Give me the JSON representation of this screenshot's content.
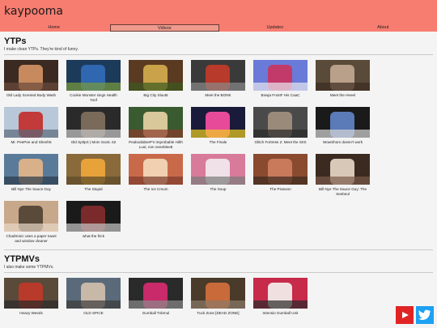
{
  "site": {
    "title": "kaypooma"
  },
  "nav": [
    {
      "label": "Home",
      "active": false
    },
    {
      "label": "Videos",
      "active": true
    },
    {
      "label": "Updates",
      "active": false
    },
    {
      "label": "About",
      "active": false
    }
  ],
  "ytps": {
    "title": "YTPs",
    "subtitle": "I make clean YTPs. They're kind of funny.",
    "videos": [
      {
        "title": "Old Lady Scented Body Wash",
        "colors": [
          "#3a2a22",
          "#c68a5e",
          "#6b4a3a"
        ]
      },
      {
        "title": "Cookie Monster sings Health Yoof",
        "colors": [
          "#1c3a5a",
          "#2f67b0",
          "#7a9b3a"
        ]
      },
      {
        "title": "Big City Sluut5",
        "colors": [
          "#5a3a20",
          "#c9a24a",
          "#3a5a20"
        ]
      },
      {
        "title": "Meet the BONK",
        "colors": [
          "#3a3a3a",
          "#b83a2a",
          "#8a8a8a"
        ]
      },
      {
        "title": "Bowja FrostF His CaaC",
        "colors": [
          "#6a7ad8",
          "#c23a6a",
          "#e8e8f0"
        ]
      },
      {
        "title": "Meet the Heeel",
        "colors": [
          "#5a4a3a",
          "#b8a08a",
          "#3a2a20"
        ]
      },
      {
        "title": "Mr. PeePee and Sheeh5",
        "colors": [
          "#b8c8d8",
          "#c23a3a",
          "#5a6a7a"
        ]
      },
      {
        "title": "Old SpIlpS | Mom Soo5. 62",
        "colors": [
          "#2a2a2a",
          "#7a6a5a",
          "#c8c8c8"
        ]
      },
      {
        "title": "PeabodabseP's Improbable Hilth Luul, non neeeblee8",
        "colors": [
          "#3a5a30",
          "#d8c89a",
          "#8a3a2a"
        ]
      },
      {
        "title": "The Finale",
        "colors": [
          "#1a1a3a",
          "#e84a9a",
          "#f0d020"
        ]
      },
      {
        "title": "Glitch Fortress 2: Meet the SIIS",
        "colors": [
          "#4a4a4a",
          "#9a8a7a",
          "#2a2a2a"
        ]
      },
      {
        "title": "WowShom doesn't work",
        "colors": [
          "#1a1a1a",
          "#5a7ab8",
          "#d8d8d8"
        ]
      },
      {
        "title": "Bill Nye The Sauce Guy",
        "colors": [
          "#5a7a9a",
          "#d8b08a",
          "#2a3a4a"
        ]
      },
      {
        "title": "The Stupid",
        "colors": [
          "#8a6a3a",
          "#e8a23a",
          "#5a4a2a"
        ]
      },
      {
        "title": "The Ice Cmum",
        "colors": [
          "#c86a4a",
          "#f0d0b0",
          "#7a3a2a"
        ]
      },
      {
        "title": "The Soup",
        "colors": [
          "#d87a9a",
          "#f0e0e8",
          "#7a7a7a"
        ]
      },
      {
        "title": "The Prasoon",
        "colors": [
          "#8a4a30",
          "#c87a5a",
          "#3a2a20"
        ]
      },
      {
        "title": "Bill Nye The Sauce Guy: The Seebeul",
        "colors": [
          "#3a2a20",
          "#d8c8b8",
          "#7a5a4a"
        ]
      },
      {
        "title": "Chadtronic uses a paper towel and window cleaner",
        "colors": [
          "#c8a88a",
          "#5a4a3a",
          "#e8d8c8"
        ]
      },
      {
        "title": "what the frick",
        "colors": [
          "#1a1a1a",
          "#7a2a2a",
          "#c8c8c8"
        ]
      }
    ]
  },
  "ytpmvs": {
    "title": "YTPMVs",
    "subtitle": "I also make some YTPMVs.",
    "videos": [
      {
        "title": "Heavy Weeds",
        "colors": [
          "#5a4a3a",
          "#b83a2a",
          "#2a2a2a"
        ]
      },
      {
        "title": "OLD SPICE",
        "colors": [
          "#5a6a7a",
          "#c8b8a8",
          "#3a3a3a"
        ]
      },
      {
        "title": "Gumball Tvbrnul",
        "colors": [
          "#2a2a2a",
          "#c82a6a",
          "#8a8a8a"
        ]
      },
      {
        "title": "Tuck Zone [DEAD ZONE]",
        "colors": [
          "#4a3a2a",
          "#c86a3a",
          "#8a7a6a"
        ]
      },
      {
        "title": "Intensio Gumball Unit",
        "colors": [
          "#c82a4a",
          "#f0e0e0",
          "#2a2a2a"
        ]
      }
    ]
  },
  "social": {
    "youtube_color": "#e02424",
    "twitter_color": "#1da1f2",
    "icons": [
      "youtube-icon",
      "twitter-icon"
    ]
  }
}
